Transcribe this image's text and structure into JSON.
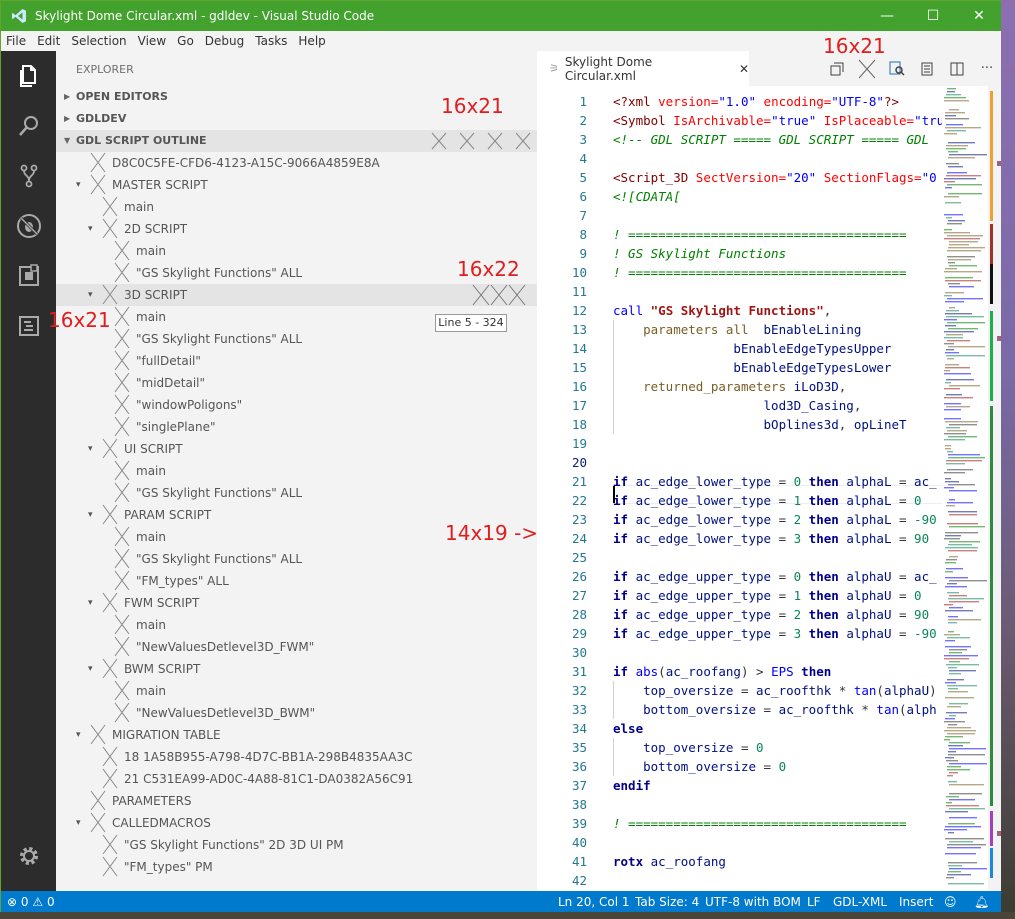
{
  "window": {
    "title": "Skylight Dome Circular.xml - gdldev - Visual Studio Code",
    "controls": {
      "minimize": "—",
      "maximize": "☐",
      "close": "✕"
    },
    "titlebar_color": "#43a22e"
  },
  "menu": [
    "File",
    "Edit",
    "Selection",
    "View",
    "Go",
    "Debug",
    "Tasks",
    "Help"
  ],
  "activity_bar": [
    "explorer-icon",
    "search-icon",
    "source-control-icon",
    "debug-icon",
    "extensions-icon",
    "outline-panel-icon",
    "settings-gear-icon"
  ],
  "sidebar": {
    "title": "EXPLORER",
    "sections": [
      {
        "label": "OPEN EDITORS",
        "expanded": false
      },
      {
        "label": "GDLDEV",
        "expanded": false
      },
      {
        "label": "GDL SCRIPT OUTLINE",
        "expanded": true
      }
    ],
    "outline": [
      {
        "label": "D8C0C5FE-CFD6-4123-A15C-9066A4859E8A",
        "level": 0,
        "twisty": ""
      },
      {
        "label": "MASTER SCRIPT",
        "level": 0,
        "twisty": "▾"
      },
      {
        "label": "main",
        "level": 1,
        "twisty": ""
      },
      {
        "label": "2D SCRIPT",
        "level": 1,
        "twisty": "▾"
      },
      {
        "label": "main",
        "level": 2,
        "twisty": ""
      },
      {
        "label": "\"GS Skylight Functions\"  ALL",
        "level": 2,
        "twisty": ""
      },
      {
        "label": "3D SCRIPT",
        "level": 1,
        "twisty": "▾"
      },
      {
        "label": "main",
        "level": 2,
        "twisty": ""
      },
      {
        "label": "\"GS Skylight Functions\"  ALL",
        "level": 2,
        "twisty": ""
      },
      {
        "label": "\"fullDetail\"",
        "level": 2,
        "twisty": ""
      },
      {
        "label": "\"midDetail\"",
        "level": 2,
        "twisty": ""
      },
      {
        "label": "\"windowPoligons\"",
        "level": 2,
        "twisty": ""
      },
      {
        "label": "\"singlePlane\"",
        "level": 2,
        "twisty": ""
      },
      {
        "label": "UI SCRIPT",
        "level": 1,
        "twisty": "▾"
      },
      {
        "label": "main",
        "level": 2,
        "twisty": ""
      },
      {
        "label": "\"GS Skylight Functions\"  ALL",
        "level": 2,
        "twisty": ""
      },
      {
        "label": "PARAM SCRIPT",
        "level": 1,
        "twisty": "▾"
      },
      {
        "label": "main",
        "level": 2,
        "twisty": ""
      },
      {
        "label": "\"GS Skylight Functions\"  ALL",
        "level": 2,
        "twisty": ""
      },
      {
        "label": "\"FM_types\"  ALL",
        "level": 2,
        "twisty": ""
      },
      {
        "label": "FWM SCRIPT",
        "level": 1,
        "twisty": "▾"
      },
      {
        "label": "main",
        "level": 2,
        "twisty": ""
      },
      {
        "label": "\"NewValuesDetlevel3D_FWM\"",
        "level": 2,
        "twisty": ""
      },
      {
        "label": "BWM SCRIPT",
        "level": 1,
        "twisty": "▾"
      },
      {
        "label": "main",
        "level": 2,
        "twisty": ""
      },
      {
        "label": "\"NewValuesDetlevel3D_BWM\"",
        "level": 2,
        "twisty": ""
      },
      {
        "label": "MIGRATION TABLE",
        "level": 0,
        "twisty": "▾"
      },
      {
        "label": "18 1A58B955-A798-4D7C-BB1A-298B4835AA3C",
        "level": 1,
        "twisty": ""
      },
      {
        "label": "21 C531EA99-AD0C-4A88-81C1-DA0382A56C91",
        "level": 1,
        "twisty": ""
      },
      {
        "label": "PARAMETERS",
        "level": 0,
        "twisty": ""
      },
      {
        "label": "CALLEDMACROS",
        "level": 0,
        "twisty": "▾"
      },
      {
        "label": "\"GS Skylight Functions\"  2D  3D  UI  PM",
        "level": 1,
        "twisty": ""
      },
      {
        "label": "\"FM_types\"  PM",
        "level": 1,
        "twisty": ""
      }
    ],
    "tooltip": "Line 5 - 324"
  },
  "annotations": [
    "16x21",
    "16x21",
    "16x22",
    "16x21",
    "14x19 ->"
  ],
  "editor": {
    "tab_label": "Skylight Dome Circular.xml",
    "tab_close": "✕",
    "actions": [
      "split-view-icon",
      "close-x-icon",
      "find-icon",
      "preview-icon",
      "split-editor-icon",
      "more-icon"
    ],
    "lines": [
      [
        [
          "t-tag",
          "<?xml "
        ],
        [
          "t-attr",
          "version="
        ],
        [
          "t-str",
          "\"1.0\""
        ],
        [
          "t-attr",
          " encoding="
        ],
        [
          "t-str",
          "\"UTF-8\""
        ],
        [
          "t-tag",
          "?>"
        ]
      ],
      [
        [
          "t-tag",
          "<Symbol "
        ],
        [
          "t-attr",
          "IsArchivable="
        ],
        [
          "t-str",
          "\"true\""
        ],
        [
          "t-attr",
          " IsPlaceable="
        ],
        [
          "t-str",
          "\"tru"
        ]
      ],
      [
        [
          "t-cmt",
          "<!-- GDL SCRIPT ===== GDL SCRIPT ===== GDL"
        ]
      ],
      [],
      [
        [
          "t-tag",
          "<Script_3D "
        ],
        [
          "t-attr",
          "SectVersion="
        ],
        [
          "t-str",
          "\"20\""
        ],
        [
          "t-attr",
          " SectionFlags="
        ],
        [
          "t-str",
          "\"0"
        ]
      ],
      [
        [
          "t-cmt",
          "<![CDATA["
        ]
      ],
      [],
      [
        [
          "t-cmt",
          "! ====================================="
        ]
      ],
      [
        [
          "t-cmt",
          "! GS Skylight Functions"
        ]
      ],
      [
        [
          "t-cmt",
          "! ====================================="
        ]
      ],
      [],
      [
        [
          "t-kw",
          "call "
        ],
        [
          "t-strb",
          "\"GS Skylight Functions\""
        ],
        [
          "t-pl",
          ","
        ]
      ],
      [
        [
          "t-pl",
          "    "
        ],
        [
          "t-fn",
          "parameters all"
        ],
        [
          "t-pl",
          "  "
        ],
        [
          "t-id",
          "bEnableLining"
        ]
      ],
      [
        [
          "t-pl",
          "                "
        ],
        [
          "t-id",
          "bEnableEdgeTypesUpper"
        ]
      ],
      [
        [
          "t-pl",
          "                "
        ],
        [
          "t-id",
          "bEnableEdgeTypesLower"
        ]
      ],
      [
        [
          "t-pl",
          "    "
        ],
        [
          "t-fn",
          "returned_parameters"
        ],
        [
          "t-pl",
          " "
        ],
        [
          "t-id",
          "iLoD3D"
        ],
        [
          "t-pl",
          ","
        ]
      ],
      [
        [
          "t-pl",
          "                    "
        ],
        [
          "t-id",
          "lod3D_Casing"
        ],
        [
          "t-pl",
          ","
        ]
      ],
      [
        [
          "t-pl",
          "                    "
        ],
        [
          "t-id",
          "bOplines3d"
        ],
        [
          "t-pl",
          ", "
        ],
        [
          "t-id",
          "opLineT"
        ]
      ],
      [],
      [],
      [
        [
          "t-kwb",
          "if "
        ],
        [
          "t-id",
          "ac_edge_lower_type"
        ],
        [
          "t-op",
          " = "
        ],
        [
          "t-num",
          "0"
        ],
        [
          "t-kwb",
          " then "
        ],
        [
          "t-id",
          "alphaL"
        ],
        [
          "t-op",
          " = "
        ],
        [
          "t-id",
          "ac_"
        ]
      ],
      [
        [
          "t-kwb",
          "if "
        ],
        [
          "t-id",
          "ac_edge_lower_type"
        ],
        [
          "t-op",
          " = "
        ],
        [
          "t-num",
          "1"
        ],
        [
          "t-kwb",
          " then "
        ],
        [
          "t-id",
          "alphaL"
        ],
        [
          "t-op",
          " = "
        ],
        [
          "t-num",
          "0"
        ]
      ],
      [
        [
          "t-kwb",
          "if "
        ],
        [
          "t-id",
          "ac_edge_lower_type"
        ],
        [
          "t-op",
          " = "
        ],
        [
          "t-num",
          "2"
        ],
        [
          "t-kwb",
          " then "
        ],
        [
          "t-id",
          "alphaL"
        ],
        [
          "t-op",
          " = "
        ],
        [
          "t-num",
          "-90"
        ]
      ],
      [
        [
          "t-kwb",
          "if "
        ],
        [
          "t-id",
          "ac_edge_lower_type"
        ],
        [
          "t-op",
          " = "
        ],
        [
          "t-num",
          "3"
        ],
        [
          "t-kwb",
          " then "
        ],
        [
          "t-id",
          "alphaL"
        ],
        [
          "t-op",
          " = "
        ],
        [
          "t-num",
          "90"
        ]
      ],
      [],
      [
        [
          "t-kwb",
          "if "
        ],
        [
          "t-id",
          "ac_edge_upper_type"
        ],
        [
          "t-op",
          " = "
        ],
        [
          "t-num",
          "0"
        ],
        [
          "t-kwb",
          " then "
        ],
        [
          "t-id",
          "alphaU"
        ],
        [
          "t-op",
          " = "
        ],
        [
          "t-id",
          "ac_"
        ]
      ],
      [
        [
          "t-kwb",
          "if "
        ],
        [
          "t-id",
          "ac_edge_upper_type"
        ],
        [
          "t-op",
          " = "
        ],
        [
          "t-num",
          "1"
        ],
        [
          "t-kwb",
          " then "
        ],
        [
          "t-id",
          "alphaU"
        ],
        [
          "t-op",
          " = "
        ],
        [
          "t-num",
          "0"
        ]
      ],
      [
        [
          "t-kwb",
          "if "
        ],
        [
          "t-id",
          "ac_edge_upper_type"
        ],
        [
          "t-op",
          " = "
        ],
        [
          "t-num",
          "2"
        ],
        [
          "t-kwb",
          " then "
        ],
        [
          "t-id",
          "alphaU"
        ],
        [
          "t-op",
          " = "
        ],
        [
          "t-num",
          "90"
        ]
      ],
      [
        [
          "t-kwb",
          "if "
        ],
        [
          "t-id",
          "ac_edge_upper_type"
        ],
        [
          "t-op",
          " = "
        ],
        [
          "t-num",
          "3"
        ],
        [
          "t-kwb",
          " then "
        ],
        [
          "t-id",
          "alphaU"
        ],
        [
          "t-op",
          " = "
        ],
        [
          "t-num",
          "-90"
        ]
      ],
      [],
      [
        [
          "t-kwb",
          "if "
        ],
        [
          "t-kw",
          "abs"
        ],
        [
          "t-pl",
          "("
        ],
        [
          "t-id",
          "ac_roofang"
        ],
        [
          "t-pl",
          ") > "
        ],
        [
          "t-kw",
          "EPS"
        ],
        [
          "t-kwb",
          " then"
        ]
      ],
      [
        [
          "t-pl",
          "    "
        ],
        [
          "t-id",
          "top_oversize"
        ],
        [
          "t-op",
          " = "
        ],
        [
          "t-id",
          "ac_roofthk"
        ],
        [
          "t-op",
          " * "
        ],
        [
          "t-kw",
          "tan"
        ],
        [
          "t-pl",
          "("
        ],
        [
          "t-id",
          "alphaU"
        ],
        [
          "t-pl",
          ")"
        ]
      ],
      [
        [
          "t-pl",
          "    "
        ],
        [
          "t-id",
          "bottom_oversize"
        ],
        [
          "t-op",
          " = "
        ],
        [
          "t-id",
          "ac_roofthk"
        ],
        [
          "t-op",
          " * "
        ],
        [
          "t-kw",
          "tan"
        ],
        [
          "t-pl",
          "("
        ],
        [
          "t-id",
          "alph"
        ]
      ],
      [
        [
          "t-kwb",
          "else"
        ]
      ],
      [
        [
          "t-pl",
          "    "
        ],
        [
          "t-id",
          "top_oversize"
        ],
        [
          "t-op",
          " = "
        ],
        [
          "t-num",
          "0"
        ]
      ],
      [
        [
          "t-pl",
          "    "
        ],
        [
          "t-id",
          "bottom_oversize"
        ],
        [
          "t-op",
          " = "
        ],
        [
          "t-num",
          "0"
        ]
      ],
      [
        [
          "t-kwb",
          "endif"
        ]
      ],
      [],
      [
        [
          "t-cmt",
          "! ====================================="
        ]
      ],
      [],
      [
        [
          "t-kwb",
          "rotx "
        ],
        [
          "t-id",
          "ac_roofang"
        ]
      ],
      [],
      [
        [
          "t-cmt",
          "!"
        ]
      ]
    ],
    "current_line": 20
  },
  "statusbar": {
    "errors": "0",
    "warnings": "0",
    "position": "Ln 20, Col 1",
    "tab_size": "Tab Size: 4",
    "encoding": "UTF-8 with BOM",
    "eol": "LF",
    "language": "GDL-XML",
    "mode": "Insert",
    "color": "#007acc"
  }
}
